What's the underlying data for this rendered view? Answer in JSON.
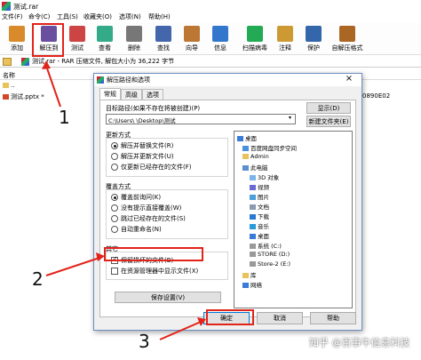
{
  "window": {
    "title": "测试.rar"
  },
  "menu": [
    "文件(F)",
    "命令(C)",
    "工具(S)",
    "收藏夹(O)",
    "选项(N)",
    "帮助(H)"
  ],
  "toolbar": [
    {
      "label": "添加",
      "icon": "add-archive-icon",
      "color": "#d98b2b"
    },
    {
      "label": "解压到",
      "icon": "extract-to-icon",
      "color": "#6a4f9e"
    },
    {
      "label": "测试",
      "icon": "test-icon",
      "color": "#c44"
    },
    {
      "label": "查看",
      "icon": "view-icon",
      "color": "#3a8"
    },
    {
      "label": "删除",
      "icon": "delete-icon",
      "color": "#777"
    },
    {
      "label": "查找",
      "icon": "find-icon",
      "color": "#46a"
    },
    {
      "label": "向导",
      "icon": "wizard-icon",
      "color": "#b73"
    },
    {
      "label": "信息",
      "icon": "info-icon",
      "color": "#37c"
    },
    {
      "label": "扫描病毒",
      "icon": "scan-virus-icon",
      "color": "#2a5"
    },
    {
      "label": "注释",
      "icon": "comment-icon",
      "color": "#c93"
    },
    {
      "label": "保护",
      "icon": "protect-icon",
      "color": "#36a"
    },
    {
      "label": "自解压格式",
      "icon": "sfx-icon",
      "color": "#a62"
    }
  ],
  "address": {
    "text": "测试.rar - RAR 压缩文件, 解包大小为 36,222 字节"
  },
  "file_list": {
    "header_name": "名称",
    "rows": [
      {
        "name": ".."
      },
      {
        "name": "测试.pptx *"
      }
    ],
    "right_value": "0890E02"
  },
  "dialog": {
    "title": "解压路径和选项",
    "tabs": [
      "常规",
      "高级",
      "选项"
    ],
    "target_label": "目标路径(如果不存在将被创建)(P)",
    "target_value": "C:\\Users\\        \\Desktop\\测试",
    "show_button": "显示(D)",
    "new_folder_button": "新建文件夹(E)",
    "update_group": {
      "title": "更新方式",
      "options": [
        "解压并替换文件(R)",
        "解压并更新文件(U)",
        "仅更新已经存在的文件(F)"
      ],
      "selected": 0
    },
    "overwrite_group": {
      "title": "覆盖方式",
      "options": [
        "覆盖前询问(K)",
        "没有提示直接覆盖(W)",
        "跳过已经存在的文件(S)",
        "自动重命名(N)"
      ],
      "selected": 0
    },
    "misc_group": {
      "title": "其它",
      "options": [
        "保留损坏的文件(B)",
        "在资源管理器中显示文件(X)"
      ],
      "checked": [
        true,
        false
      ]
    },
    "save_settings_button": "保存设置(V)",
    "tree": [
      {
        "label": "桌面",
        "level": 0,
        "icon": "desktop-icon"
      },
      {
        "label": "百度网盘同步空间",
        "level": 1,
        "icon": "cloud-folder-icon"
      },
      {
        "label": "Admin",
        "level": 1,
        "icon": "user-folder-icon"
      },
      {
        "label": "此电脑",
        "level": 1,
        "icon": "computer-icon"
      },
      {
        "label": "3D 对象",
        "level": 2,
        "icon": "3d-objects-icon"
      },
      {
        "label": "视频",
        "level": 2,
        "icon": "video-folder-icon"
      },
      {
        "label": "图片",
        "level": 2,
        "icon": "pictures-folder-icon"
      },
      {
        "label": "文档",
        "level": 2,
        "icon": "documents-folder-icon"
      },
      {
        "label": "下载",
        "level": 2,
        "icon": "downloads-folder-icon"
      },
      {
        "label": "音乐",
        "level": 2,
        "icon": "music-folder-icon"
      },
      {
        "label": "桌面",
        "level": 2,
        "icon": "desktop-folder-icon"
      },
      {
        "label": "系统 (C:)",
        "level": 2,
        "icon": "drive-icon"
      },
      {
        "label": "STORE (D:)",
        "level": 2,
        "icon": "drive-icon"
      },
      {
        "label": "Store-2 (E:)",
        "level": 2,
        "icon": "drive-icon"
      },
      {
        "label": "库",
        "level": 1,
        "icon": "library-icon"
      },
      {
        "label": "网络",
        "level": 1,
        "icon": "network-icon"
      }
    ],
    "ok_button": "确定",
    "cancel_button": "取消",
    "help_button": "帮助"
  },
  "annotations": {
    "n1": "1",
    "n2": "2",
    "n3": "3",
    "highlight_color": "#e2231a"
  },
  "watermark": "知乎 @百事牛信息科技"
}
